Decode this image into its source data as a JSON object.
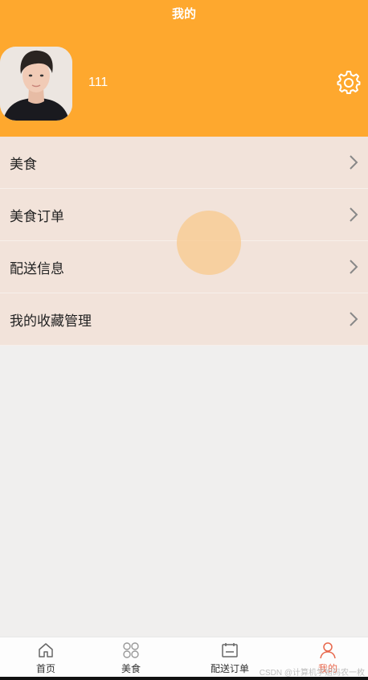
{
  "header": {
    "title": "我的",
    "username": "111",
    "background_color": "#fea82e"
  },
  "menu": {
    "items": [
      {
        "label": "美食"
      },
      {
        "label": "美食订单"
      },
      {
        "label": "配送信息"
      },
      {
        "label": "我的收藏管理"
      }
    ]
  },
  "tabbar": {
    "tabs": [
      {
        "label": "首页",
        "icon": "home-icon"
      },
      {
        "label": "美食",
        "icon": "grid-icon"
      },
      {
        "label": "配送订单",
        "icon": "calendar-icon"
      },
      {
        "label": "我的",
        "icon": "person-icon",
        "active": true
      }
    ],
    "active_color": "#e8664a"
  },
  "watermark": "CSDN @计算机学姐码农一枚"
}
